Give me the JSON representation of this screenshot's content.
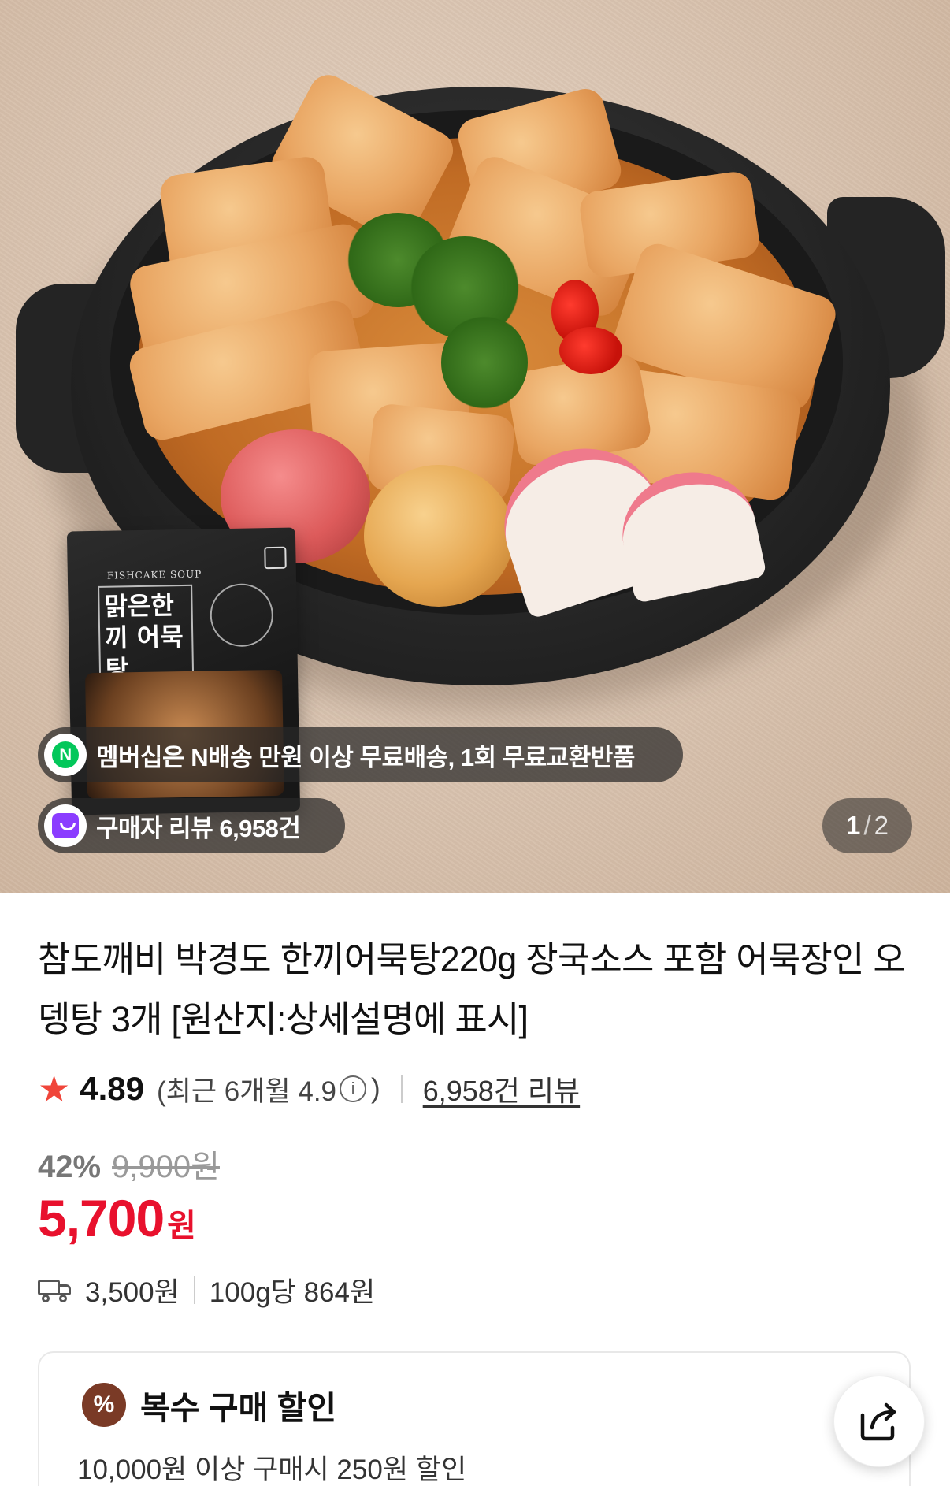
{
  "hero": {
    "package_label_en": "FISHCAKE SOUP",
    "package_title": "맑은한끼 어묵탕",
    "chips": {
      "membership_text": "멤버십은 N배송 만원 이상 무료배송, 1회 무료교환반품",
      "review_text": "구매자 리뷰 6,958건"
    },
    "page_indicator": {
      "current": "1",
      "separator": "/",
      "total": "2"
    }
  },
  "product": {
    "title": "참도깨비 박경도 한끼어묵탕220g 장국소스 포함 어묵장인 오뎅탕 3개 [원산지:상세설명에 표시]",
    "rating": "4.89",
    "recent_rating_prefix": "(최근 6개월 4.9",
    "recent_rating_suffix": ")",
    "review_link": "6,958건 리뷰",
    "discount_rate": "42%",
    "original_price": "9,900원",
    "sale_price": "5,700",
    "sale_unit": "원",
    "shipping_fee": "3,500원",
    "unit_price": "100g당 864원"
  },
  "promo": {
    "title": "복수 구매 할인",
    "description": "10,000원 이상 구매시 250원 할인"
  },
  "colors": {
    "sale_red": "#e8112d",
    "star_red": "#f0453a",
    "naver_green": "#03c75a",
    "bag_purple": "#8b3dff"
  },
  "icons": [
    "star-icon",
    "info-icon",
    "truck-icon",
    "percent-icon",
    "share-icon",
    "naver-n-icon",
    "shopping-bag-icon"
  ]
}
